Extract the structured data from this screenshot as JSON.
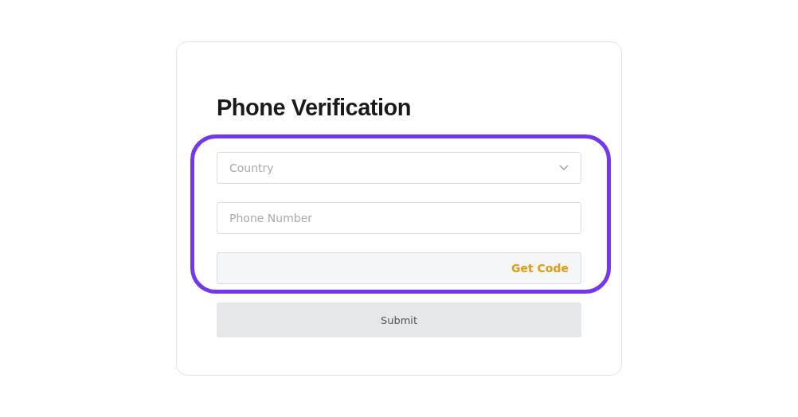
{
  "title": "Phone Verification",
  "form": {
    "highlighted": true,
    "country": {
      "placeholder": "Country"
    },
    "phone": {
      "placeholder": "Phone Number"
    },
    "code": {
      "button": "Get Code"
    }
  },
  "submit": {
    "label": "Submit",
    "disabled": true
  }
}
